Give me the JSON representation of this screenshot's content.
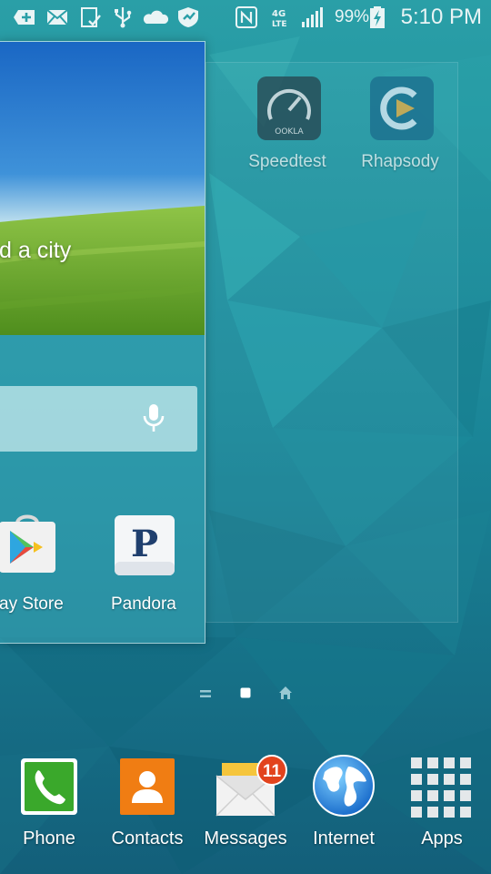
{
  "status_bar": {
    "battery": "99%",
    "time": "5:10 PM",
    "icons": [
      "add-icon",
      "mail-icon",
      "clipboard-check-icon",
      "usb-icon",
      "cloud-icon",
      "shield-icon",
      "nfc-icon",
      "4g-lte-icon",
      "signal-icon",
      "battery-charging-icon"
    ]
  },
  "front_page": {
    "weather_text": "d a city",
    "apps": [
      {
        "label": "ay Store",
        "icon": "play-store-icon"
      },
      {
        "label": "Pandora",
        "icon": "pandora-icon"
      }
    ]
  },
  "back_page": {
    "apps": [
      {
        "label": "Speedtest",
        "icon": "speedtest-icon",
        "icon_text": "OOKLA"
      },
      {
        "label": "Rhapsody",
        "icon": "rhapsody-icon"
      }
    ]
  },
  "indicators": {
    "current": 2,
    "items": [
      "menu-indicator",
      "dot-indicator",
      "home-indicator"
    ]
  },
  "dock": [
    {
      "label": "Phone",
      "icon": "phone-icon"
    },
    {
      "label": "Contacts",
      "icon": "contacts-icon"
    },
    {
      "label": "Messages",
      "icon": "messages-icon",
      "badge": "11"
    },
    {
      "label": "Internet",
      "icon": "globe-icon"
    },
    {
      "label": "Apps",
      "icon": "apps-grid-icon"
    }
  ],
  "colors": {
    "accent_badge": "#e2431d",
    "phone_green": "#3aa82b",
    "contacts_orange": "#f07d13"
  }
}
